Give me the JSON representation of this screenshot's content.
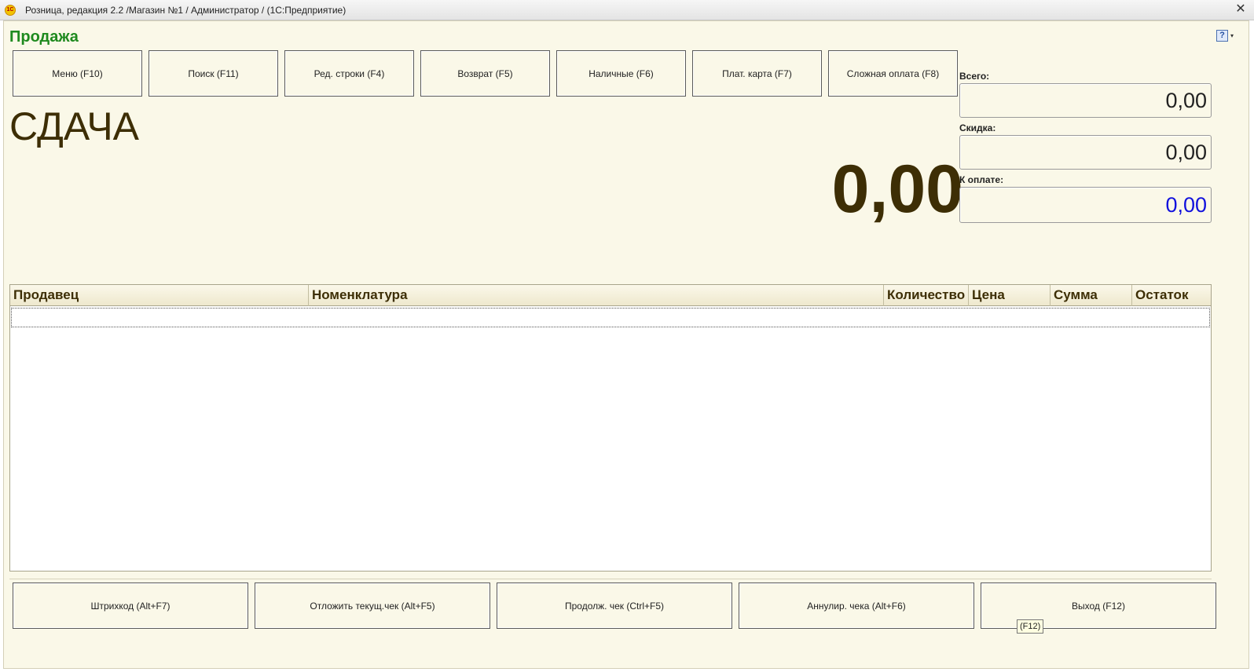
{
  "window": {
    "title": "Розница, редакция 2.2 /Магазин №1 / Администратор /  (1С:Предприятие)",
    "app_icon": "1C",
    "close_symbol": "✕"
  },
  "form": {
    "title": "Продажа",
    "help_symbol": "?",
    "help_arrow": "▾"
  },
  "top_buttons": [
    {
      "label": "Меню (F10)"
    },
    {
      "label": "Поиск (F11)"
    },
    {
      "label": "Ред. строки (F4)"
    },
    {
      "label": "Возврат (F5)"
    },
    {
      "label": "Наличные (F6)"
    },
    {
      "label": "Плат. карта (F7)"
    },
    {
      "label": "Сложная оплата (F8)"
    }
  ],
  "change": {
    "label": "СДАЧА",
    "value": "0,00"
  },
  "totals": {
    "total_label": "Всего:",
    "total_value": "0,00",
    "discount_label": "Скидка:",
    "discount_value": "0,00",
    "to_pay_label": "К оплате:",
    "to_pay_value": "0,00",
    "to_pay_color": "#1111dd"
  },
  "table": {
    "columns": [
      "Продавец",
      "Номенклатура",
      "Количество",
      "Цена",
      "Сумма",
      "Остаток"
    ],
    "rows": []
  },
  "bottom_buttons": [
    {
      "label": "Штрихкод (Alt+F7)"
    },
    {
      "label": "Отложить текущ.чек (Alt+F5)"
    },
    {
      "label": "Продолж. чек (Ctrl+F5)"
    },
    {
      "label": "Аннулир. чека (Alt+F6)"
    },
    {
      "label": "Выход (F12)"
    }
  ],
  "tooltip": "(F12)"
}
